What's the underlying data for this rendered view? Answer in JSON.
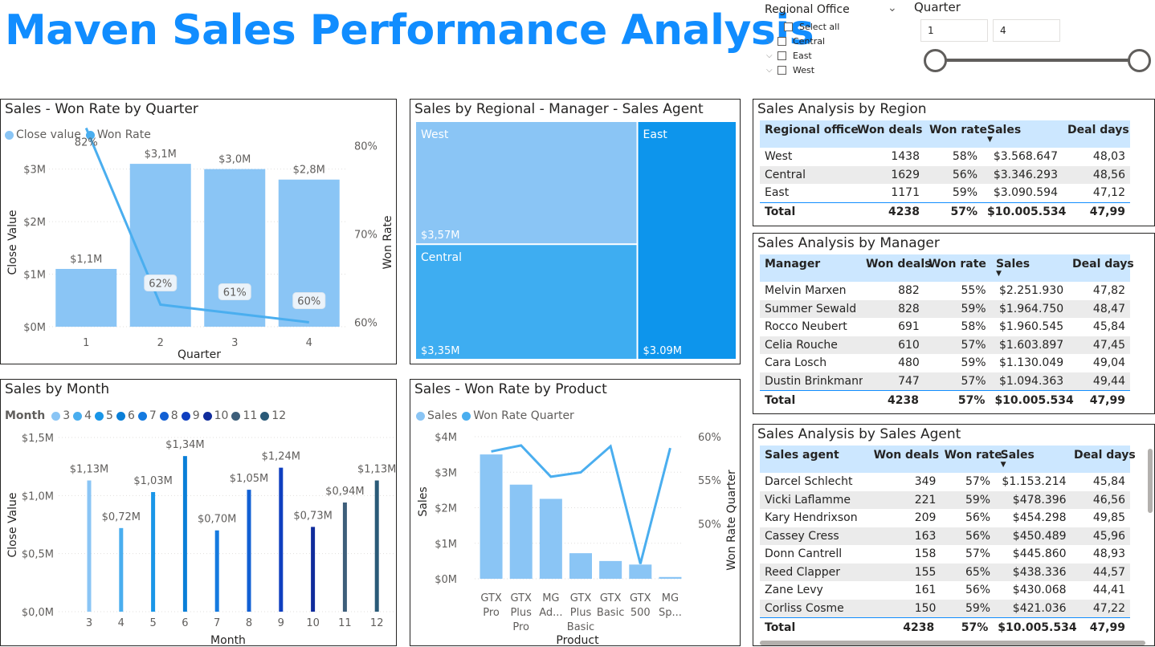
{
  "title": "Maven Sales Performance Analysis",
  "slicer_region": {
    "header": "Regional Office",
    "items": [
      {
        "label": "Select all"
      },
      {
        "label": "Central"
      },
      {
        "label": "East"
      },
      {
        "label": "West"
      }
    ]
  },
  "slicer_quarter": {
    "header": "Quarter",
    "min": "1",
    "max": "4"
  },
  "panel1": {
    "title": "Sales - Won Rate by Quarter",
    "legend": [
      "Close value",
      "Won Rate"
    ]
  },
  "panel2": {
    "title": "Sales by Regional - Manager - Sales Agent"
  },
  "panel3": {
    "title": "Sales by Month",
    "legend_title": "Month"
  },
  "panel4": {
    "title": "Sales - Won Rate by Product",
    "legend": [
      "Sales",
      "Won Rate Quarter"
    ]
  },
  "chart_data": [
    {
      "id": "quarter",
      "type": "bar",
      "title": "Sales - Won Rate by Quarter",
      "xlabel": "Quarter",
      "ylabel": "Close Value",
      "y2label": "Won Rate",
      "categories": [
        "1",
        "2",
        "3",
        "4"
      ],
      "series": [
        {
          "name": "Close value",
          "values": [
            1.1,
            3.1,
            3.0,
            2.8
          ],
          "labels": [
            "$1,1M",
            "$3,1M",
            "$3,0M",
            "$2,8M"
          ],
          "color": "#8AC5F5"
        },
        {
          "name": "Won Rate",
          "type": "line",
          "values": [
            82,
            62,
            61,
            60
          ],
          "labels": [
            "82%",
            "62%",
            "61%",
            "60%"
          ],
          "color": "#4AAEEF"
        }
      ],
      "yticks": [
        "$0M",
        "$1M",
        "$2M",
        "$3M"
      ],
      "ylim": [
        0,
        3.3
      ],
      "y2ticks": [
        "60%",
        "70%",
        "80%"
      ],
      "y2lim": [
        59.5,
        81.5
      ]
    },
    {
      "id": "treemap",
      "type": "treemap",
      "title": "Sales by Regional - Manager - Sales Agent",
      "nodes": [
        {
          "name": "West",
          "value": 3.57,
          "label": "$3,57M",
          "color": "#8AC5F5"
        },
        {
          "name": "Central",
          "value": 3.35,
          "label": "$3,35M",
          "color": "#3EADF1"
        },
        {
          "name": "East",
          "value": 3.09,
          "label": "$3.09M",
          "color": "#0D95EC"
        }
      ]
    },
    {
      "id": "month",
      "type": "bar",
      "title": "Sales by Month",
      "xlabel": "Month",
      "ylabel": "Close Value",
      "legend_title": "Month",
      "categories": [
        "3",
        "4",
        "5",
        "6",
        "7",
        "8",
        "9",
        "10",
        "11",
        "12"
      ],
      "values": [
        1.13,
        0.72,
        1.03,
        1.34,
        0.7,
        1.05,
        1.24,
        0.73,
        0.94,
        1.13
      ],
      "labels": [
        "$1,13M",
        "$0,72M",
        "$1,03M",
        "$1,34M",
        "$0,70M",
        "$1,05M",
        "$1,24M",
        "$0,73M",
        "$0,94M",
        "$1,13M"
      ],
      "colors": [
        "#8AC5F5",
        "#4AAEEF",
        "#1A96E8",
        "#0A7FD8",
        "#147AE0",
        "#1260D4",
        "#0F3FC0",
        "#102C9C",
        "#3D5E7A",
        "#2A5A78"
      ],
      "yticks": [
        "$0,0M",
        "$0,5M",
        "$1,0M",
        "$1,5M"
      ],
      "ylim": [
        0,
        1.5
      ]
    },
    {
      "id": "product",
      "type": "bar",
      "title": "Sales - Won Rate by Product",
      "xlabel": "Product",
      "ylabel": "Sales",
      "y2label": "Won Rate Quarter",
      "categories": [
        [
          "GTX",
          "Pro"
        ],
        [
          "GTX",
          "Plus",
          "Pro"
        ],
        [
          "MG",
          "Ad..."
        ],
        [
          "GTX",
          "Plus",
          "Basic"
        ],
        [
          "GTX",
          "Basic"
        ],
        [
          "GTX",
          "500"
        ],
        [
          "MG",
          "Sp..."
        ]
      ],
      "series": [
        {
          "name": "Sales",
          "values": [
            3.5,
            2.65,
            2.25,
            0.72,
            0.5,
            0.4,
            0.05
          ],
          "color": "#8AC5F5"
        },
        {
          "name": "Won Rate Quarter",
          "type": "line",
          "values": [
            58.3,
            59.0,
            55.4,
            55.9,
            58.9,
            45.4,
            58.7
          ],
          "color": "#4AAEEF"
        }
      ],
      "yticks": [
        "$0M",
        "$1M",
        "$2M",
        "$3M",
        "$4M"
      ],
      "ylim": [
        0,
        4
      ],
      "y2ticks": [
        "50%",
        "55%",
        "60%"
      ],
      "y2lim": [
        44.6,
        60.0
      ]
    }
  ],
  "table_region": {
    "title": "Sales Analysis by Region",
    "columns": [
      "Regional office",
      "Won deals",
      "Won rate",
      "Sales",
      "Deal days"
    ],
    "rows": [
      [
        "West",
        "1438",
        "58%",
        "$3.568.647",
        "48,03"
      ],
      [
        "Central",
        "1629",
        "56%",
        "$3.346.293",
        "48,56"
      ],
      [
        "East",
        "1171",
        "59%",
        "$3.090.594",
        "47,12"
      ]
    ],
    "total": [
      "Total",
      "4238",
      "57%",
      "$10.005.534",
      "47,99"
    ]
  },
  "table_manager": {
    "title": "Sales Analysis by Manager",
    "columns": [
      "Manager",
      "Won deals",
      "Won rate",
      "Sales",
      "Deal days"
    ],
    "rows": [
      [
        "Melvin Marxen",
        "882",
        "55%",
        "$2.251.930",
        "47,82"
      ],
      [
        "Summer Sewald",
        "828",
        "59%",
        "$1.964.750",
        "48,47"
      ],
      [
        "Rocco Neubert",
        "691",
        "58%",
        "$1.960.545",
        "45,84"
      ],
      [
        "Celia Rouche",
        "610",
        "57%",
        "$1.603.897",
        "47,45"
      ],
      [
        "Cara Losch",
        "480",
        "59%",
        "$1.130.049",
        "49,04"
      ],
      [
        "Dustin Brinkmann",
        "747",
        "57%",
        "$1.094.363",
        "49,44"
      ]
    ],
    "total": [
      "Total",
      "4238",
      "57%",
      "$10.005.534",
      "47,99"
    ]
  },
  "table_agent": {
    "title": "Sales Analysis by Sales Agent",
    "columns": [
      "Sales agent",
      "Won deals",
      "Won rate",
      "Sales",
      "Deal days"
    ],
    "rows": [
      [
        "Darcel Schlecht",
        "349",
        "57%",
        "$1.153.214",
        "45,84"
      ],
      [
        "Vicki Laflamme",
        "221",
        "59%",
        "$478.396",
        "46,56"
      ],
      [
        "Kary Hendrixson",
        "209",
        "56%",
        "$454.298",
        "49,85"
      ],
      [
        "Cassey Cress",
        "163",
        "56%",
        "$450.489",
        "45,96"
      ],
      [
        "Donn Cantrell",
        "158",
        "57%",
        "$445.860",
        "48,93"
      ],
      [
        "Reed Clapper",
        "155",
        "65%",
        "$438.336",
        "44,57"
      ],
      [
        "Zane Levy",
        "161",
        "56%",
        "$430.068",
        "44,41"
      ],
      [
        "Corliss Cosme",
        "150",
        "59%",
        "$421.036",
        "47,22"
      ]
    ],
    "total": [
      "Total",
      "4238",
      "57%",
      "$10.005.534",
      "47,99"
    ]
  }
}
